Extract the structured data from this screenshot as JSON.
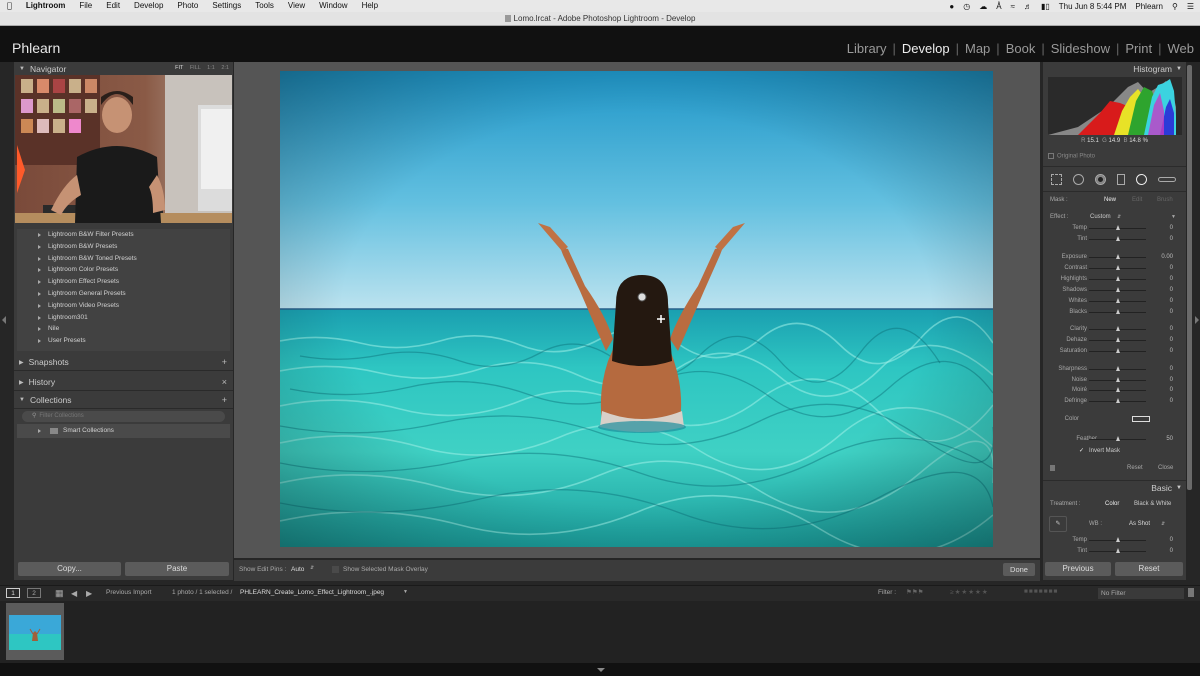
{
  "menubar": {
    "apple": "",
    "app": "Lightroom",
    "items": [
      "File",
      "Edit",
      "Develop",
      "Photo",
      "Settings",
      "Tools",
      "View",
      "Window",
      "Help"
    ],
    "datetime": "Thu Jun 8  5:44 PM",
    "user": "Phlearn"
  },
  "window_title": "Lomo.lrcat - Adobe Photoshop Lightroom - Develop",
  "identity": {
    "name": "Phlearn"
  },
  "modules": [
    "Library",
    "Develop",
    "Map",
    "Book",
    "Slideshow",
    "Print",
    "Web"
  ],
  "active_module": "Develop",
  "left": {
    "navigator": {
      "title": "Navigator",
      "zoom": [
        "FIT",
        "FILL",
        "1:1",
        "2:1"
      ]
    },
    "presets": [
      "Lightroom B&W Filter Presets",
      "Lightroom B&W Presets",
      "Lightroom B&W Toned Presets",
      "Lightroom Color Presets",
      "Lightroom Effect Presets",
      "Lightroom General Presets",
      "Lightroom Video Presets",
      "Lightroom301",
      "Nile",
      "User Presets"
    ],
    "snapshots": "Snapshots",
    "history": "History",
    "collections": "Collections",
    "collection_filter_placeholder": "Filter Collections",
    "smart_collections": "Smart Collections",
    "copy_btn": "Copy...",
    "paste_btn": "Paste"
  },
  "toolbar": {
    "show_edit_pins_label": "Show Edit Pins :",
    "show_edit_pins_value": "Auto",
    "mask_overlay": "Show Selected Mask Overlay",
    "done": "Done"
  },
  "right": {
    "histogram": "Histogram",
    "rgb": {
      "r_label": "R",
      "r": "15.1",
      "g_label": "G",
      "g": "14.9",
      "b_label": "B",
      "b": "14.8",
      "unit": "%"
    },
    "original_photo": "Original Photo",
    "mask": {
      "label": "Mask :",
      "new": "New",
      "edit": "Edit",
      "brush": "Brush"
    },
    "effect": {
      "label": "Effect :",
      "value": "Custom"
    },
    "sliders": [
      {
        "label": "Temp",
        "value": "0"
      },
      {
        "label": "Tint",
        "value": "0"
      },
      {
        "label": "Exposure",
        "value": "0.00"
      },
      {
        "label": "Contrast",
        "value": "0"
      },
      {
        "label": "Highlights",
        "value": "0"
      },
      {
        "label": "Shadows",
        "value": "0"
      },
      {
        "label": "Whites",
        "value": "0"
      },
      {
        "label": "Blacks",
        "value": "0"
      },
      {
        "label": "Clarity",
        "value": "0"
      },
      {
        "label": "Dehaze",
        "value": "0"
      },
      {
        "label": "Saturation",
        "value": "0"
      },
      {
        "label": "Sharpness",
        "value": "0"
      },
      {
        "label": "Noise",
        "value": "0"
      },
      {
        "label": "Moiré",
        "value": "0"
      },
      {
        "label": "Defringe",
        "value": "0"
      }
    ],
    "color_label": "Color",
    "feather": {
      "label": "Feather",
      "value": "50"
    },
    "invert_mask": "Invert Mask",
    "reset": "Reset",
    "close": "Close",
    "basic": "Basic",
    "treatment": {
      "label": "Treatment :",
      "color": "Color",
      "bw": "Black & White"
    },
    "wb": {
      "label": "WB :",
      "value": "As Shot"
    },
    "basic_sliders": [
      {
        "label": "Temp",
        "value": "0"
      },
      {
        "label": "Tint",
        "value": "0"
      }
    ],
    "previous_btn": "Previous",
    "reset_btn": "Reset"
  },
  "filmstrip": {
    "pages": [
      "1",
      "2"
    ],
    "source": "Previous Import",
    "count": "1 photo / 1 selected /",
    "filename": "PHLEARN_Create_Lomo_Effect_Lightroom_.jpeg",
    "filter_label": "Filter :",
    "filter_value": "No Filter"
  },
  "colors": {
    "accent": "#e8e8e8",
    "panel": "#3b3b3b",
    "background": "#262626"
  }
}
